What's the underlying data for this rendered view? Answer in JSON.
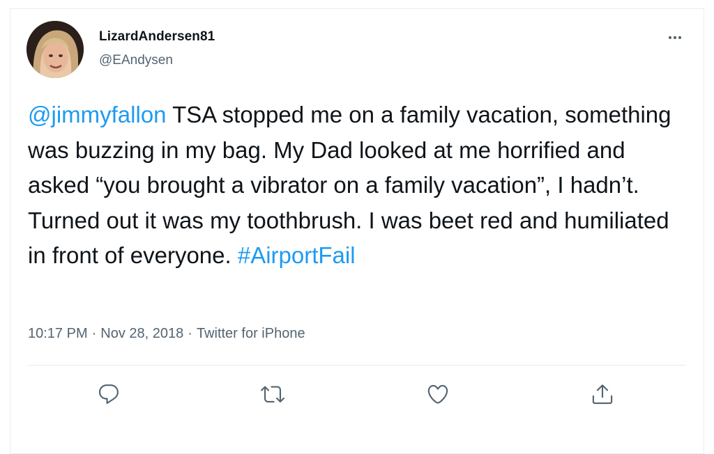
{
  "tweet": {
    "author": {
      "display_name": "LizardAndersen81",
      "handle": "@EAndysen"
    },
    "text": {
      "mention": "@jimmyfallon",
      "body": " TSA stopped me on a family vacation, something was buzzing in my bag. My Dad looked at me horrified and asked “you brought a vibrator on a family vacation”, I hadn’t. Turned out it was my toothbrush. I was beet red and humiliated in front of everyone. ",
      "hashtag": "#AirportFail"
    },
    "meta": {
      "time": "10:17 PM",
      "date": "Nov 28, 2018",
      "source": "Twitter for iPhone",
      "separator": "·"
    }
  },
  "icons": {
    "more": "more-horizontal-icon",
    "reply": "reply-icon",
    "retweet": "retweet-icon",
    "like": "heart-icon",
    "share": "share-icon"
  },
  "colors": {
    "link": "#1d9bf0",
    "text": "#0f1419",
    "secondary": "#536471",
    "border": "#e6ecf0"
  }
}
